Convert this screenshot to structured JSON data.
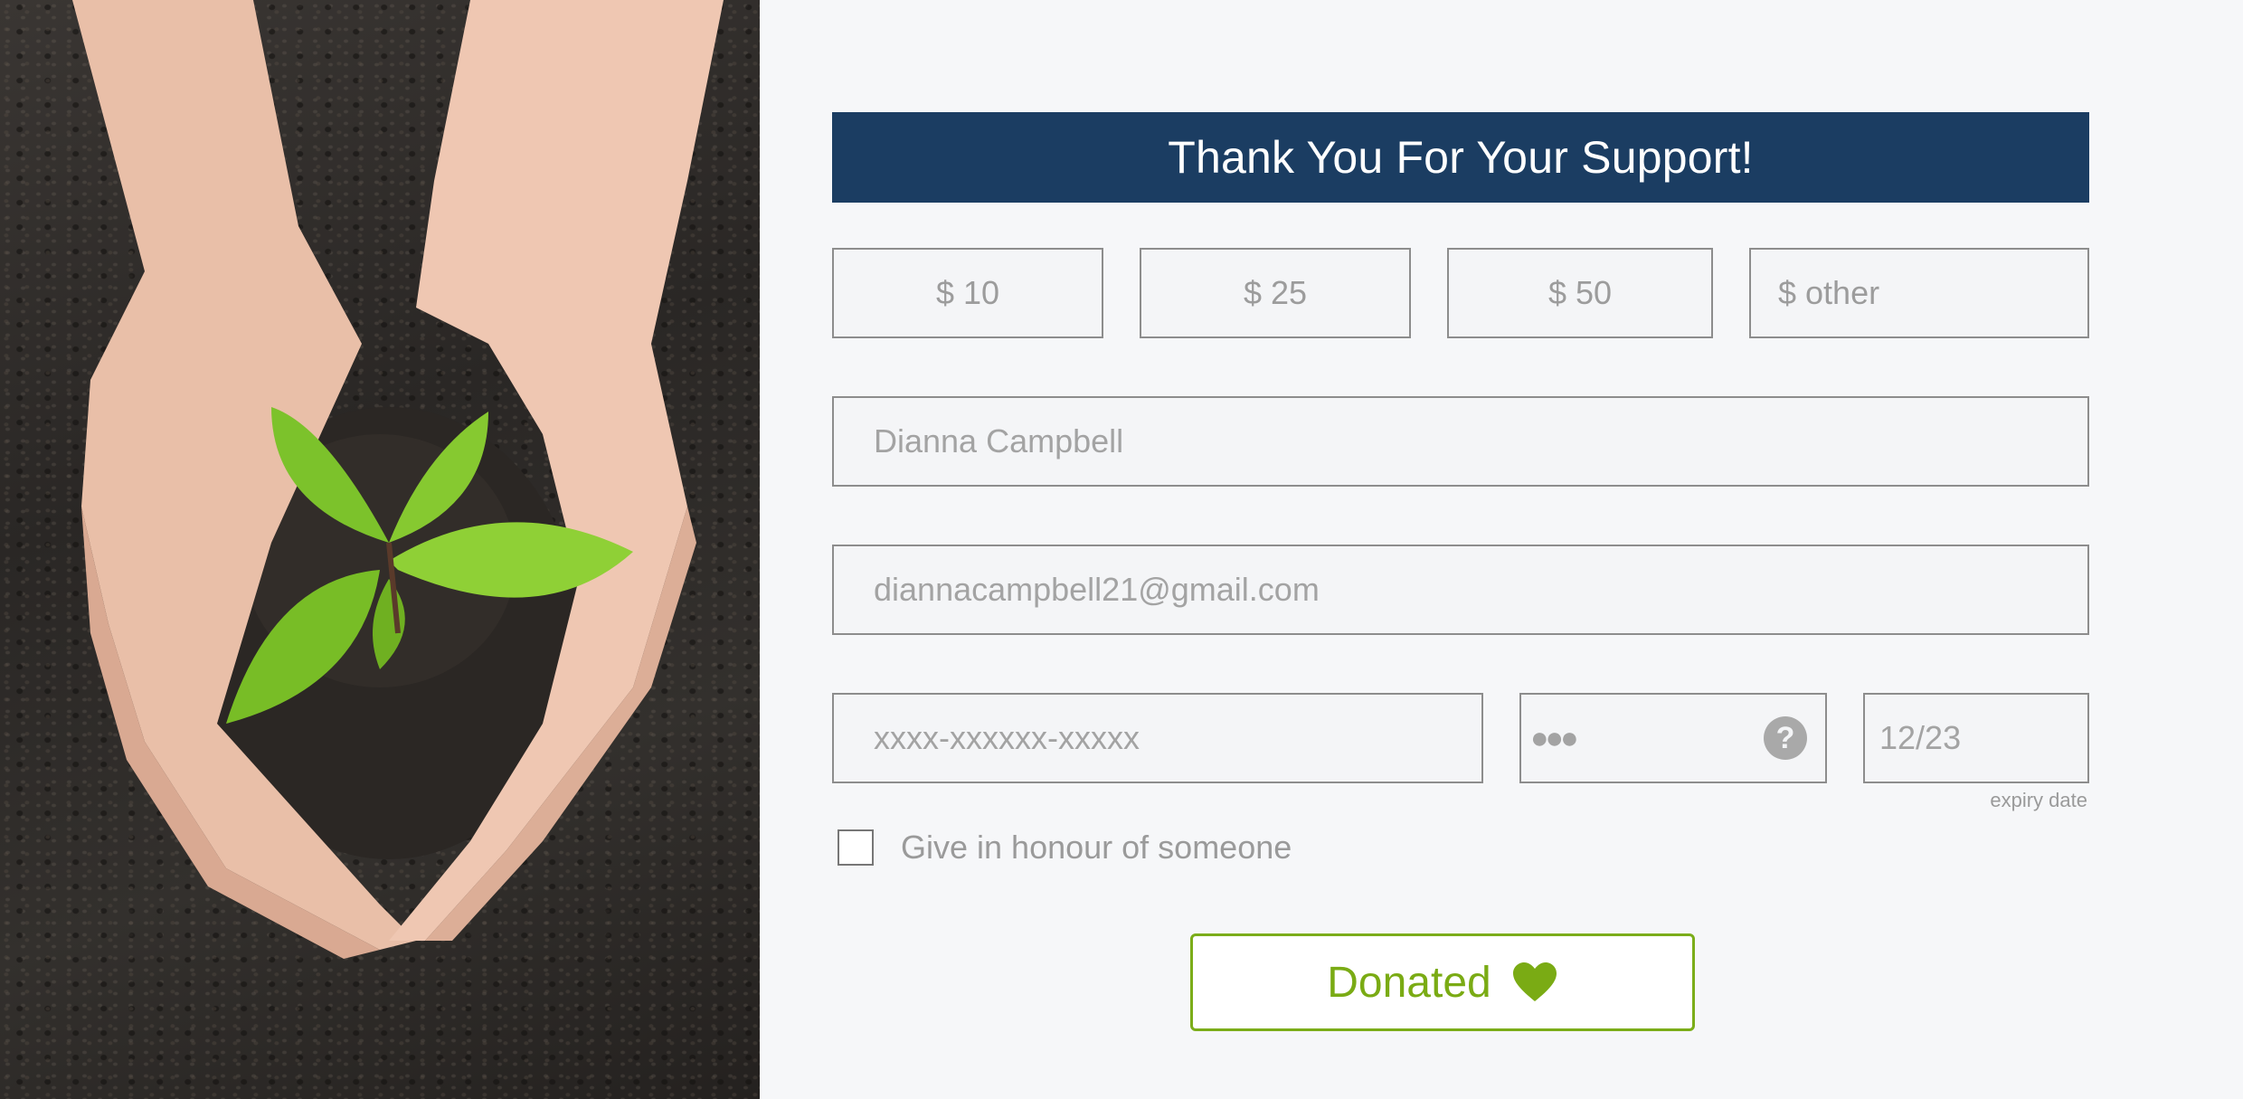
{
  "header": {
    "title": "Thank You For Your Support!"
  },
  "amounts": [
    {
      "label": "$ 10"
    },
    {
      "label": "$ 25"
    },
    {
      "label": "$ 50"
    },
    {
      "label": "$ other"
    }
  ],
  "form": {
    "name_value": "Dianna Campbell",
    "email_value": "diannacampbell21@gmail.com",
    "card_placeholder": "xxxx-xxxxxx-xxxxx",
    "cvv_value": "●●●",
    "help_symbol": "?",
    "expiry_value": "12/23",
    "expiry_label": "expiry date",
    "honour_label": "Give in honour of someone"
  },
  "donate_button": {
    "label": "Donated",
    "icon": "heart-icon"
  },
  "photo": {
    "icon": "hands-holding-seedling-photo"
  },
  "colors": {
    "banner": "#1b3d62",
    "accent_green": "#7aab14",
    "background": "#f6f7f9"
  }
}
